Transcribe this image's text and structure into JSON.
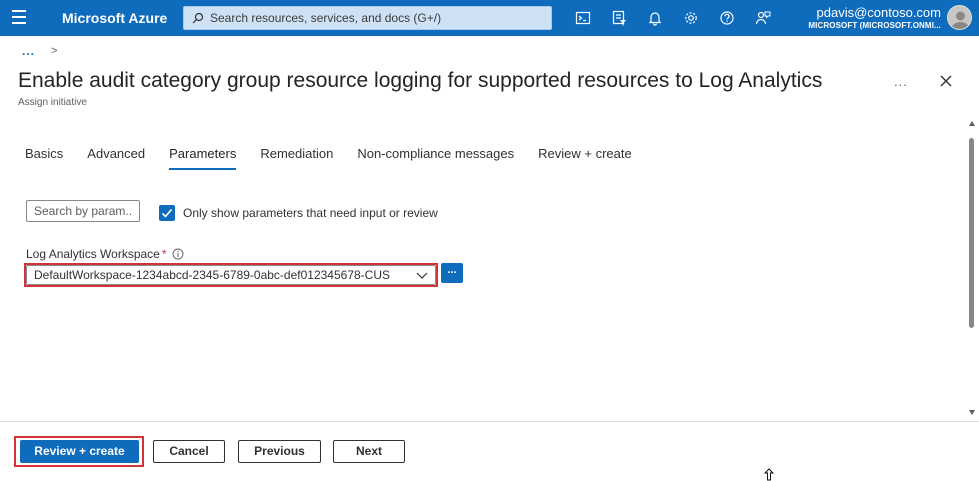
{
  "topbar": {
    "brand": "Microsoft Azure",
    "search_placeholder": "Search resources, services, and docs (G+/)",
    "account_email": "pdavis@contoso.com",
    "account_tenant": "MICROSOFT (MICROSOFT.ONMI...",
    "icons": [
      "cloud-shell-icon",
      "directory-filter-icon",
      "notifications-icon",
      "settings-icon",
      "help-icon",
      "feedback-icon"
    ],
    "bg_color": "#0f6cbd"
  },
  "breadcrumb": {
    "ellipsis": "...",
    "separator": ">"
  },
  "page": {
    "title": "Enable audit category group resource logging for supported resources to Log Analytics",
    "subtitle": "Assign initiative",
    "more": "...",
    "close_icon": "close-icon"
  },
  "tabs": [
    {
      "label": "Basics",
      "active": false
    },
    {
      "label": "Advanced",
      "active": false
    },
    {
      "label": "Parameters",
      "active": true
    },
    {
      "label": "Remediation",
      "active": false
    },
    {
      "label": "Non-compliance messages",
      "active": false
    },
    {
      "label": "Review + create",
      "active": false
    }
  ],
  "filter": {
    "search_placeholder": "Search by param...",
    "checkbox_checked": true,
    "checkbox_label": "Only show parameters that need input or review"
  },
  "field": {
    "label": "Log Analytics Workspace",
    "required_mark": "*",
    "value": "DefaultWorkspace-1234abcd-2345-6789-0abc-def012345678-CUS",
    "browse_label": "..."
  },
  "footer": {
    "review_create": "Review + create",
    "cancel": "Cancel",
    "previous": "Previous",
    "next": "Next"
  },
  "colors": {
    "accent": "#0f6cbd",
    "highlight": "#d13438"
  }
}
